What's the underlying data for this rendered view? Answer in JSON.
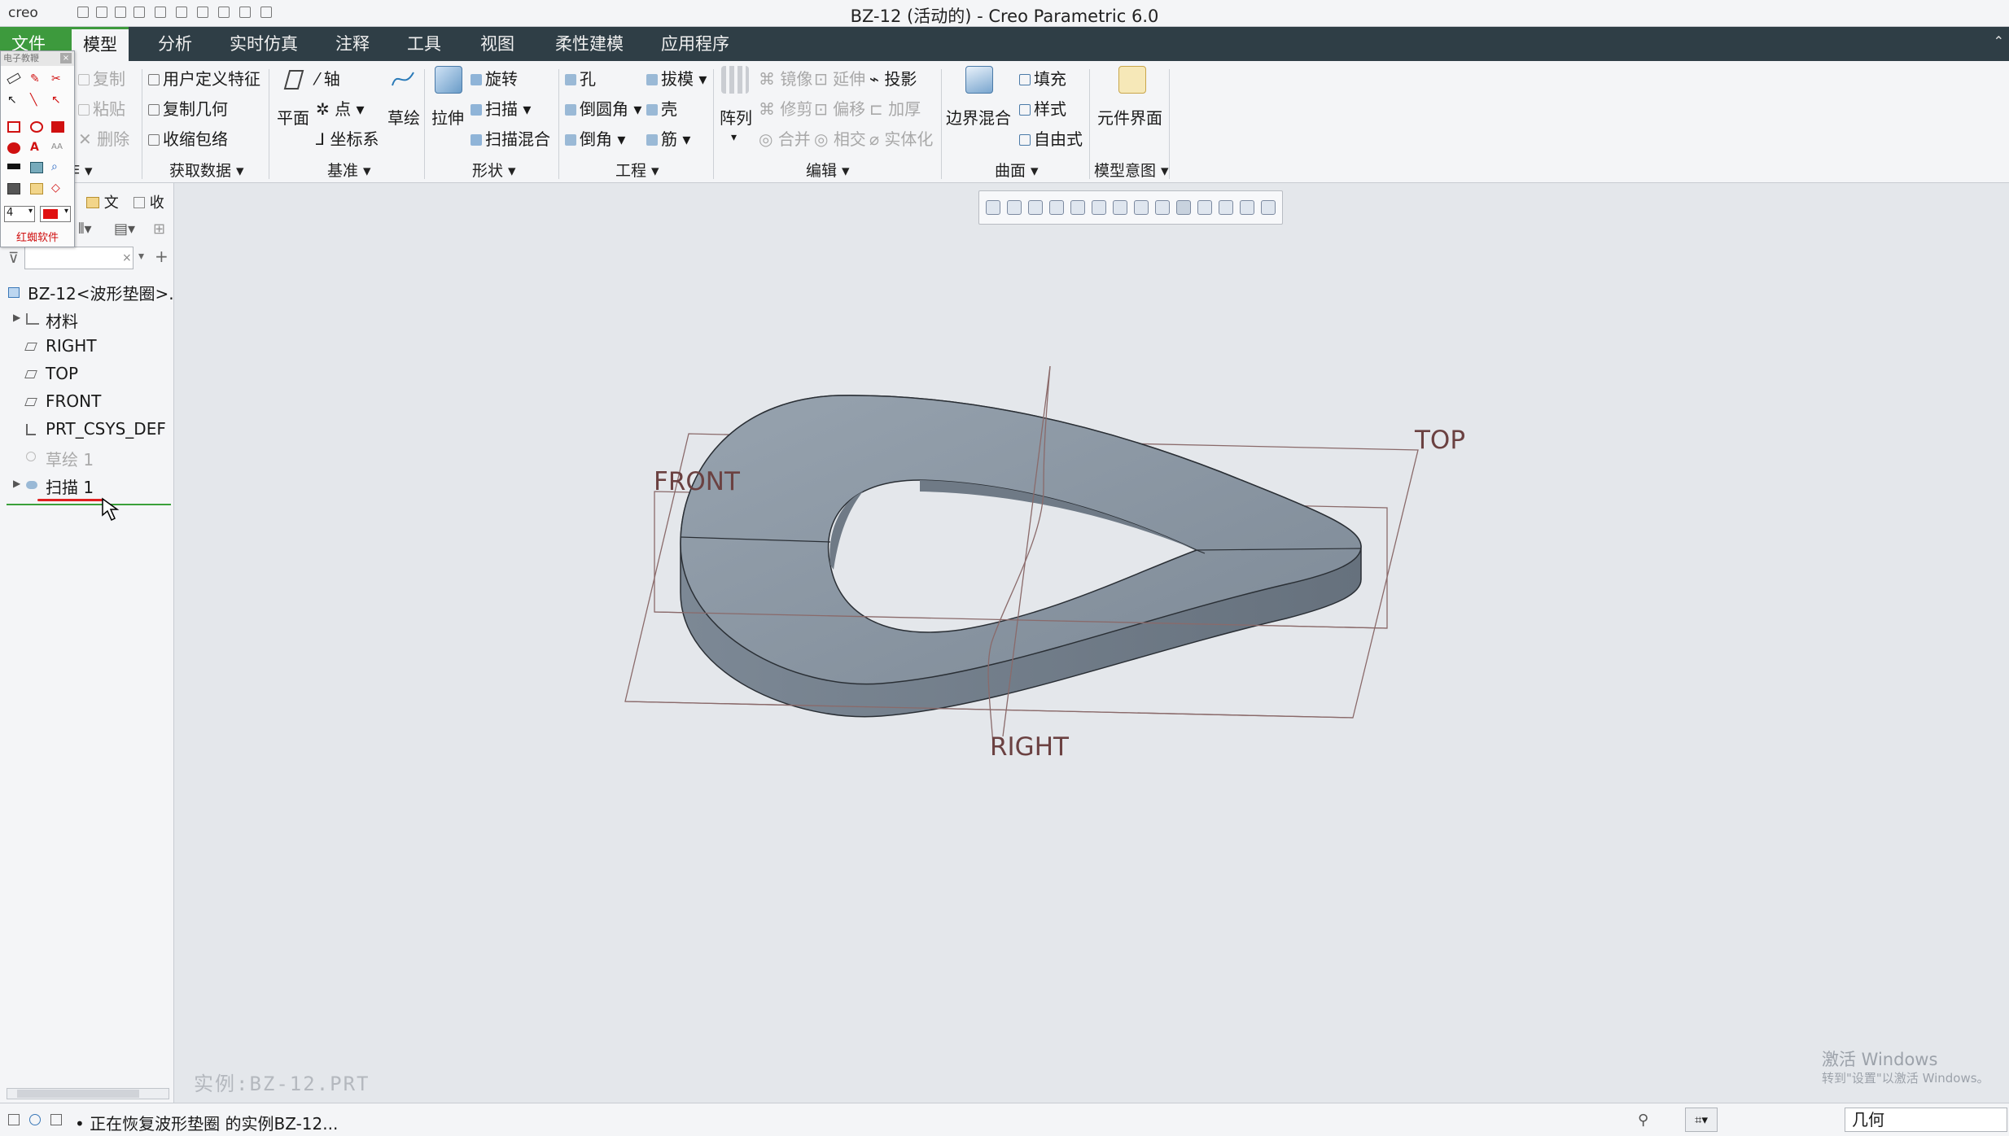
{
  "app": {
    "logo": "creo",
    "window_title": "BZ-12 (活动的) - Creo Parametric 6.0"
  },
  "tabs": [
    "文件",
    "模型",
    "分析",
    "实时仿真",
    "注释",
    "工具",
    "视图",
    "柔性建模",
    "应用程序"
  ],
  "active_tab": "模型",
  "ribbon": {
    "operations": {
      "copy": "复制",
      "paste": "粘贴",
      "delete": "删除",
      "group": "操作"
    },
    "get_data": {
      "udf": "用户定义特征",
      "copy_geom": "复制几何",
      "shrinkwrap": "收缩包络",
      "group": "获取数据"
    },
    "datum": {
      "plane": "平面",
      "axis": "轴",
      "point": "点",
      "csys": "坐标系",
      "sketch": "草绘",
      "group": "基准"
    },
    "shapes": {
      "extrude": "拉伸",
      "revolve": "旋转",
      "sweep": "扫描",
      "swept_blend": "扫描混合",
      "group": "形状"
    },
    "engineering": {
      "hole": "孔",
      "round": "倒圆角",
      "chamfer": "倒角",
      "draft": "拔模",
      "shell": "壳",
      "rib": "筋",
      "group": "工程"
    },
    "editing": {
      "pattern": "阵列",
      "mirror": "镜像",
      "extend": "延伸",
      "project": "投影",
      "trim": "修剪",
      "offset": "偏移",
      "thicken": "加厚",
      "merge": "合并",
      "intersect": "相交",
      "solidify": "实体化",
      "group": "编辑"
    },
    "surfaces": {
      "boundary_blend": "边界混合",
      "fill": "填充",
      "style": "样式",
      "freestyle": "自由式",
      "group": "曲面"
    },
    "model_intent": {
      "component_interface": "元件界面",
      "group": "模型意图"
    }
  },
  "palette": {
    "title": "电子教鞭",
    "line_width": "4",
    "footer": "红蜘软件",
    "colors": {
      "pen_red": "#e01010"
    }
  },
  "left_panel": {
    "tabs": [
      "文",
      "收"
    ],
    "search": {
      "value": "",
      "placeholder": ""
    },
    "tree": [
      {
        "label": "BZ-12<波形垫圈>.",
        "icon": "part-icon",
        "expandable": false,
        "dimmed": false
      },
      {
        "label": "材料",
        "icon": "material-icon",
        "expandable": true,
        "dimmed": false
      },
      {
        "label": "RIGHT",
        "icon": "datum-plane-icon",
        "expandable": false,
        "dimmed": false
      },
      {
        "label": "TOP",
        "icon": "datum-plane-icon",
        "expandable": false,
        "dimmed": false
      },
      {
        "label": "FRONT",
        "icon": "datum-plane-icon",
        "expandable": false,
        "dimmed": false
      },
      {
        "label": "PRT_CSYS_DEF",
        "icon": "csys-icon",
        "expandable": false,
        "dimmed": false
      },
      {
        "label": "草绘 1",
        "icon": "sketch-icon",
        "expandable": false,
        "dimmed": true
      },
      {
        "label": "扫描 1",
        "icon": "sweep-icon",
        "expandable": true,
        "dimmed": false
      }
    ]
  },
  "viewport": {
    "datum_labels": {
      "front": "FRONT",
      "top": "TOP",
      "right": "RIGHT"
    },
    "instance_label": "实例:BZ-12.PRT",
    "watermark": {
      "line1": "激活 Windows",
      "line2": "转到\"设置\"以激活 Windows。"
    }
  },
  "status": {
    "message": "• 正在恢复波形垫圈 的实例BZ-12...",
    "filter_value": "几何"
  },
  "colors": {
    "tab_bar": "#2f3e46",
    "file_tab": "#3d9a3d",
    "model_face": "#8e9aa7",
    "datum_label": "#6b4141"
  }
}
